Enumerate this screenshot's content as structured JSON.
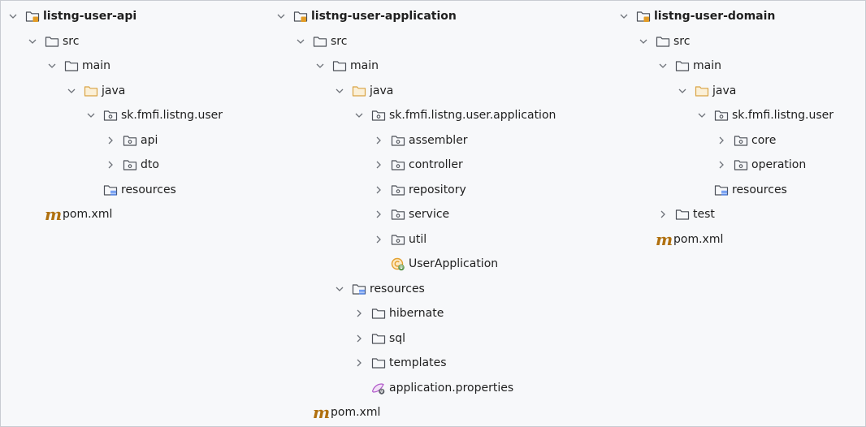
{
  "columns": [
    {
      "id": "col-a",
      "rows": [
        {
          "depth": 0,
          "arrow": "down",
          "icon": "module",
          "label": "listng-user-api",
          "bold": true
        },
        {
          "depth": 1,
          "arrow": "down",
          "icon": "folder",
          "label": "src"
        },
        {
          "depth": 2,
          "arrow": "down",
          "icon": "folder",
          "label": "main"
        },
        {
          "depth": 3,
          "arrow": "down",
          "icon": "folder-java",
          "label": "java"
        },
        {
          "depth": 4,
          "arrow": "down",
          "icon": "package",
          "label": "sk.fmfi.listng.user"
        },
        {
          "depth": 5,
          "arrow": "right",
          "icon": "package",
          "label": "api"
        },
        {
          "depth": 5,
          "arrow": "right",
          "icon": "package",
          "label": "dto"
        },
        {
          "depth": 4,
          "arrow": "none",
          "icon": "resources",
          "label": "resources"
        },
        {
          "depth": 1,
          "arrow": "none",
          "icon": "maven",
          "label": "pom.xml"
        }
      ]
    },
    {
      "id": "col-b",
      "rows": [
        {
          "depth": 0,
          "arrow": "down",
          "icon": "module",
          "label": "listng-user-application",
          "bold": true
        },
        {
          "depth": 1,
          "arrow": "down",
          "icon": "folder",
          "label": "src"
        },
        {
          "depth": 2,
          "arrow": "down",
          "icon": "folder",
          "label": "main"
        },
        {
          "depth": 3,
          "arrow": "down",
          "icon": "folder-java",
          "label": "java"
        },
        {
          "depth": 4,
          "arrow": "down",
          "icon": "package",
          "label": "sk.fmfi.listng.user.application"
        },
        {
          "depth": 5,
          "arrow": "right",
          "icon": "package",
          "label": "assembler"
        },
        {
          "depth": 5,
          "arrow": "right",
          "icon": "package",
          "label": "controller"
        },
        {
          "depth": 5,
          "arrow": "right",
          "icon": "package",
          "label": "repository"
        },
        {
          "depth": 5,
          "arrow": "right",
          "icon": "package",
          "label": "service"
        },
        {
          "depth": 5,
          "arrow": "right",
          "icon": "package",
          "label": "util"
        },
        {
          "depth": 5,
          "arrow": "none",
          "icon": "spring-class",
          "label": "UserApplication"
        },
        {
          "depth": 3,
          "arrow": "down",
          "icon": "resources",
          "label": "resources"
        },
        {
          "depth": 4,
          "arrow": "right",
          "icon": "folder",
          "label": "hibernate"
        },
        {
          "depth": 4,
          "arrow": "right",
          "icon": "folder",
          "label": "sql"
        },
        {
          "depth": 4,
          "arrow": "right",
          "icon": "folder",
          "label": "templates"
        },
        {
          "depth": 4,
          "arrow": "none",
          "icon": "properties",
          "label": "application.properties"
        },
        {
          "depth": 1,
          "arrow": "none",
          "icon": "maven",
          "label": "pom.xml"
        }
      ]
    },
    {
      "id": "col-c",
      "rows": [
        {
          "depth": 0,
          "arrow": "down",
          "icon": "module",
          "label": "listng-user-domain",
          "bold": true
        },
        {
          "depth": 1,
          "arrow": "down",
          "icon": "folder",
          "label": "src"
        },
        {
          "depth": 2,
          "arrow": "down",
          "icon": "folder",
          "label": "main"
        },
        {
          "depth": 3,
          "arrow": "down",
          "icon": "folder-java",
          "label": "java"
        },
        {
          "depth": 4,
          "arrow": "down",
          "icon": "package",
          "label": "sk.fmfi.listng.user"
        },
        {
          "depth": 5,
          "arrow": "right",
          "icon": "package",
          "label": "core"
        },
        {
          "depth": 5,
          "arrow": "right",
          "icon": "package",
          "label": "operation"
        },
        {
          "depth": 4,
          "arrow": "none",
          "icon": "resources",
          "label": "resources"
        },
        {
          "depth": 2,
          "arrow": "right",
          "icon": "folder",
          "label": "test"
        },
        {
          "depth": 1,
          "arrow": "none",
          "icon": "maven",
          "label": "pom.xml"
        }
      ]
    }
  ],
  "maven_glyph": "m",
  "colors": {
    "arrow": "#6f737a",
    "folder": "#4c5058",
    "java_folder": "#d9a343",
    "resources_lines": "#3574f0",
    "module_badge": "#e39c26",
    "maven": "#b0700f",
    "spring": "#e3a12f",
    "properties": "#b058c9"
  }
}
